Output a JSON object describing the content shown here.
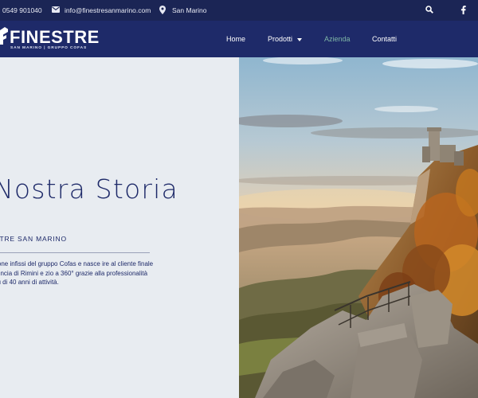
{
  "topbar": {
    "phone": "0549 901040",
    "email": "info@finestresanmarino.com",
    "location": "San Marino",
    "icons": {
      "email": "envelope-icon",
      "location": "map-pin-icon",
      "search": "search-icon",
      "social": "facebook-icon"
    }
  },
  "brand": {
    "name": "FINESTRE",
    "tagline": "SAN MARINO | GRUPPO COFAS"
  },
  "nav": {
    "items": [
      {
        "label": "Home",
        "active": false
      },
      {
        "label": "Prodotti",
        "active": false,
        "has_dropdown": true
      },
      {
        "label": "Azienda",
        "active": true
      },
      {
        "label": "Contatti",
        "active": false
      }
    ]
  },
  "hero": {
    "title": "Nostra Storia",
    "subtitle": "STRE SAN MARINO",
    "body": "è la divisione infissi del gruppo Cofas e nasce ire al cliente finale nella provincia di Rimini e zio a 360° grazie alla professionalità ed a in più di 40 anni di attività."
  },
  "colors": {
    "topbar_bg": "#1b2555",
    "nav_bg": "#1e2a69",
    "accent_active": "#7fb6a6",
    "panel_bg": "#e8ecf1",
    "text_primary": "#1e2a69"
  }
}
